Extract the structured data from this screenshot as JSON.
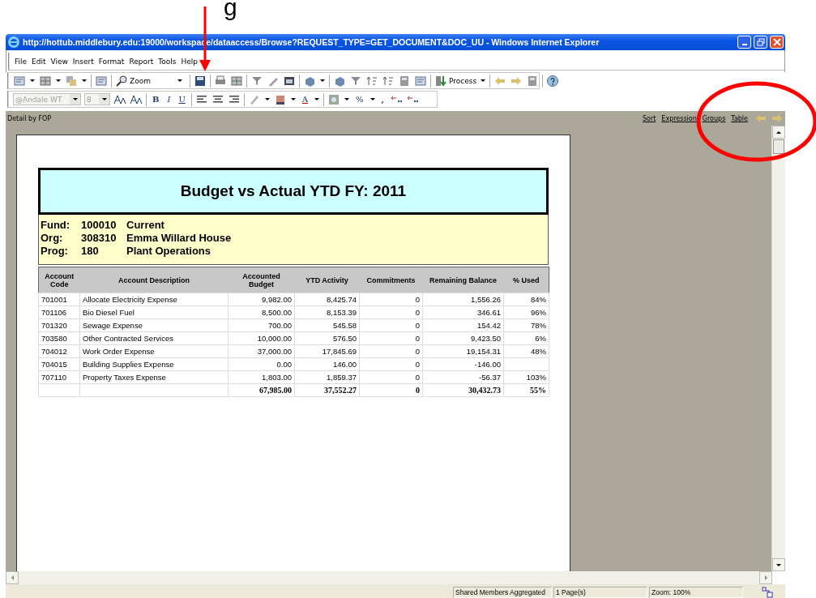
{
  "annotation": {
    "text": "g"
  },
  "window": {
    "title": "http://hottub.middlebury.edu:19000/workspace/dataaccess/Browse?REQUEST_TYPE=GET_DOCUMENT&DOC_UU - Windows Internet Explorer"
  },
  "menu": [
    "File",
    "Edit",
    "View",
    "Insert",
    "Format",
    "Report",
    "Tools",
    "Help"
  ],
  "toolbar": {
    "zoom_label": "Zoom",
    "process_label": "Process",
    "font_box": {
      "value": "@Andale WT",
      "disabled": true
    },
    "size_box": {
      "value": "8",
      "disabled": true
    },
    "format_buttons": [
      "B",
      "I",
      "U"
    ],
    "font_color": "A",
    "percent": "%",
    "comma": ","
  },
  "panel": {
    "title": "Detail by FOP",
    "links": [
      "Sort",
      "Expression",
      "Groups",
      "Table"
    ]
  },
  "report": {
    "title": "Budget vs Actual YTD FY: 2011",
    "info": [
      {
        "label": "Fund:",
        "code": "100010",
        "name": "Current"
      },
      {
        "label": "Org:",
        "code": "308310",
        "name": "Emma Willard House"
      },
      {
        "label": "Prog:",
        "code": "180",
        "name": "Plant Operations"
      }
    ],
    "columns": [
      "Account Code",
      "Account Description",
      "Accounted Budget",
      "YTD Activity",
      "Commitments",
      "Remaining Balance",
      "% Used"
    ],
    "rows": [
      {
        "code": "701001",
        "description": "Allocate Electricity Expense",
        "budget": "9,982.00",
        "ytd": "8,425.74",
        "commitments": "0",
        "remaining": "1,556.26",
        "used": "84%"
      },
      {
        "code": "701106",
        "description": "Bio Diesel Fuel",
        "budget": "8,500.00",
        "ytd": "8,153.39",
        "commitments": "0",
        "remaining": "346.61",
        "used": "96%"
      },
      {
        "code": "701320",
        "description": "Sewage Expense",
        "budget": "700.00",
        "ytd": "545.58",
        "commitments": "0",
        "remaining": "154.42",
        "used": "78%"
      },
      {
        "code": "703580",
        "description": "Other Contracted Services",
        "budget": "10,000.00",
        "ytd": "576.50",
        "commitments": "0",
        "remaining": "9,423.50",
        "used": "6%"
      },
      {
        "code": "704012",
        "description": "Work Order Expense",
        "budget": "37,000.00",
        "ytd": "17,845.69",
        "commitments": "0",
        "remaining": "19,154.31",
        "used": "48%"
      },
      {
        "code": "704015",
        "description": "Building Supplies Expense",
        "budget": "0.00",
        "ytd": "146.00",
        "commitments": "0",
        "remaining": "-146.00"
      },
      {
        "code": "707110",
        "description": "Property Taxes Expense",
        "budget": "1,803.00",
        "ytd": "1,859.37",
        "commitments": "0",
        "remaining": "-56.37",
        "used": "103%"
      }
    ],
    "total": {
      "budget": "67,985.00",
      "ytd": "37,552.27",
      "commitments": "0",
      "remaining": "30,432.73",
      "used": "55%"
    }
  },
  "status_bar": [
    "Shared Members Aggregated",
    "1 Page(s)",
    "Zoom: 100%"
  ]
}
